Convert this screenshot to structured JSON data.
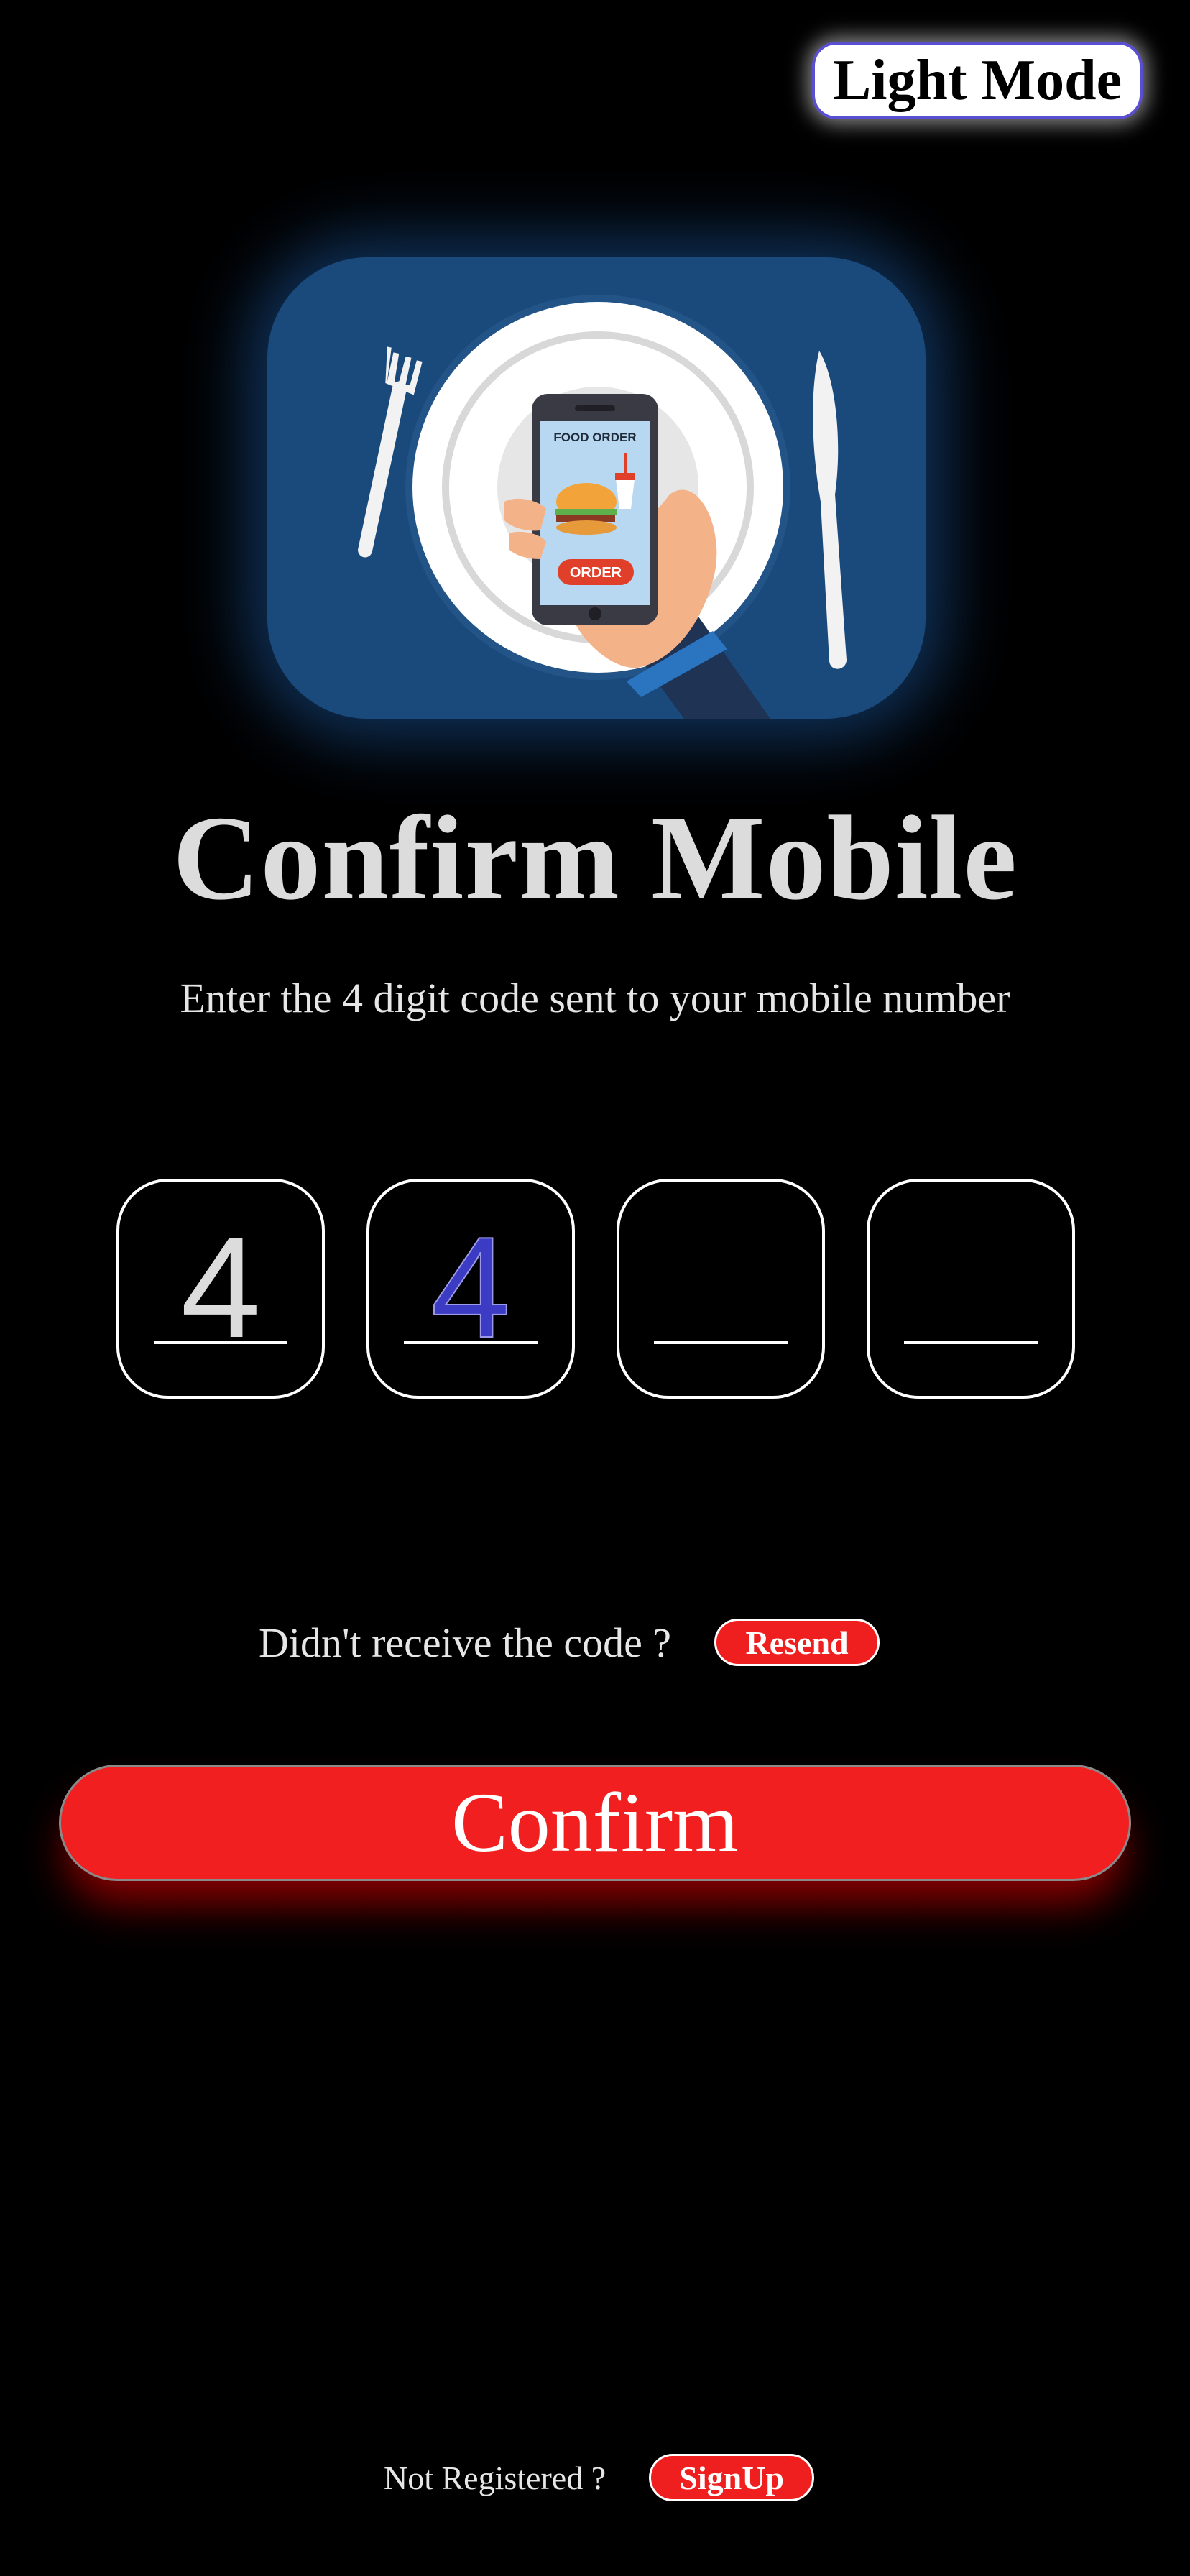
{
  "theme_toggle": {
    "label": "Light Mode"
  },
  "hero": {
    "phone_heading": "FOOD ORDER",
    "phone_button": "ORDER"
  },
  "title": "Confirm Mobile",
  "subtitle": "Enter the 4 digit code sent to your mobile number",
  "otp": {
    "digits": [
      "4",
      "4",
      "",
      ""
    ],
    "active_color": "#3b3bc4",
    "filled_color": "#dcdcdc"
  },
  "resend": {
    "prompt": "Didn't receive the code ?",
    "button_label": "Resend"
  },
  "confirm_button": {
    "label": "Confirm"
  },
  "signup": {
    "prompt": "Not Registered ?",
    "button_label": "SignUp"
  },
  "colors": {
    "background": "#000000",
    "accent_red": "#f21f20",
    "toggle_border": "#5b4fd1",
    "hero_blue": "#1a4a7c"
  }
}
